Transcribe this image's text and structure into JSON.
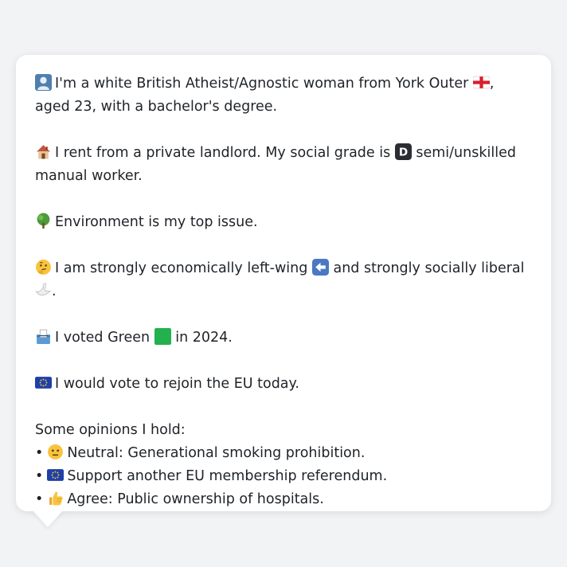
{
  "profile": {
    "identity_pre": "I'm a white British Atheist/Agnostic woman from York Outer ",
    "identity_post": ", aged 23, with a bachelor's degree.",
    "housing_pre": "I rent from a private landlord. My social grade is ",
    "housing_post": " semi/unskilled manual worker.",
    "issue": "Environment is my top issue.",
    "politics_pre": "I am strongly economically left-wing ",
    "politics_mid": " and strongly socially liberal ",
    "politics_post": ".",
    "vote_pre": "I voted Green ",
    "vote_post": " in 2024.",
    "eu": "I would vote to rejoin the EU today.",
    "opinions_heading": "Some opinions I hold:",
    "opinions": [
      {
        "icon": "neutral-face-icon",
        "text": "Neutral: Generational smoking prohibition."
      },
      {
        "icon": "eu-flag-icon",
        "text": "Support another EU membership referendum."
      },
      {
        "icon": "thumbs-up-icon",
        "text": "Agree: Public ownership of hospitals."
      }
    ]
  },
  "icons": {
    "person": "person-silhouette-icon",
    "england_flag": "england-flag-icon",
    "house": "house-icon",
    "grade_letter": "D",
    "tree": "tree-icon",
    "thinking": "thinking-face-icon",
    "left_arrow": "left-arrow-icon",
    "dove": "dove-icon",
    "ballot": "ballot-box-icon",
    "green_square": "green-square-icon",
    "eu_flag": "eu-flag-icon"
  },
  "colors": {
    "background": "#f2f3f5",
    "bubble": "#ffffff",
    "text": "#1f2328",
    "green": "#22b14c",
    "eu_blue": "#1f3fa8",
    "eu_star": "#f4d03f"
  }
}
